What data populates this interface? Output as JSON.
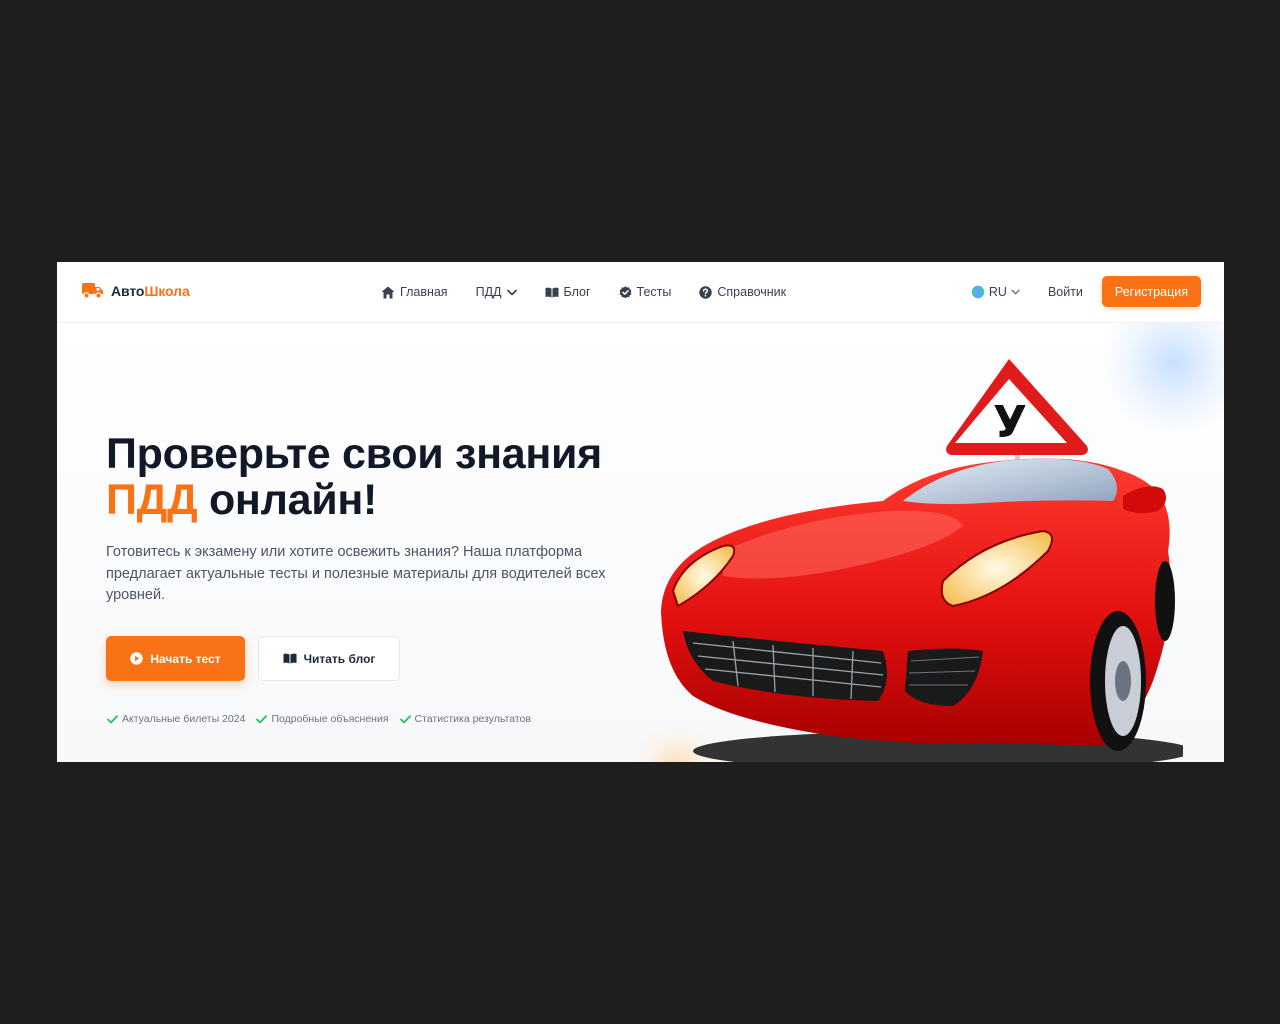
{
  "brand": {
    "name_part1": "Авто",
    "name_part2": "Школа",
    "accent_color": "#f97316",
    "icon": "truck-icon"
  },
  "nav": {
    "items": [
      {
        "label": "Главная",
        "icon": "home-icon"
      },
      {
        "label": "ПДД",
        "icon": "chevron-down-icon"
      },
      {
        "label": "Блог",
        "icon": "book-open-icon"
      },
      {
        "label": "Тесты",
        "icon": "check-circle-icon"
      },
      {
        "label": "Справочник",
        "icon": "question-circle-icon"
      }
    ]
  },
  "header_right": {
    "language": "RU",
    "login_label": "Войти",
    "register_label": "Регистрация"
  },
  "hero": {
    "title_line1": "Проверьте свои знания",
    "title_accent": "ПДД",
    "title_rest": "онлайн!",
    "description": "Готовитесь к экзамену или хотите освежить знания? Наша платформа предлагает актуальные тесты и полезные материалы для водителей всех уровней.",
    "primary_button": "Начать тест",
    "secondary_button": "Читать блог",
    "features": [
      "Актуальные билеты 2024",
      "Подробные объяснения",
      "Статистика результатов"
    ],
    "sign_letter": "У"
  }
}
